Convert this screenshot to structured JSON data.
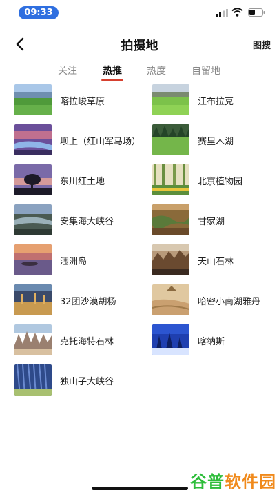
{
  "status_bar": {
    "time": "09:33",
    "icons": [
      "signal-icon",
      "wifi-icon",
      "battery-icon"
    ]
  },
  "header": {
    "title": "拍摄地",
    "right_action": "图搜",
    "back_icon": "chevron-left-icon"
  },
  "tabs": [
    {
      "label": "关注",
      "active": false
    },
    {
      "label": "热推",
      "active": true
    },
    {
      "label": "热度",
      "active": false
    },
    {
      "label": "自留地",
      "active": false
    }
  ],
  "places": [
    {
      "name": "喀拉峻草原",
      "thumb": "grassland"
    },
    {
      "name": "江布拉克",
      "thumb": "green-field"
    },
    {
      "name": "坝上（红山军马场）",
      "thumb": "purple-river"
    },
    {
      "name": "赛里木湖",
      "thumb": "lake-forest"
    },
    {
      "name": "东川红土地",
      "thumb": "tree-sunset"
    },
    {
      "name": "北京植物园",
      "thumb": "botanical-garden"
    },
    {
      "name": "安集海大峡谷",
      "thumb": "canyon"
    },
    {
      "name": "甘家湖",
      "thumb": "wetland"
    },
    {
      "name": "涠洲岛",
      "thumb": "island-sunset"
    },
    {
      "name": "天山石林",
      "thumb": "stone-forest"
    },
    {
      "name": "32团沙漠胡杨",
      "thumb": "desert-poplar"
    },
    {
      "name": "哈密小南湖雅丹",
      "thumb": "yardang"
    },
    {
      "name": "克托海特石林",
      "thumb": "rock-spires"
    },
    {
      "name": "喀纳斯",
      "thumb": "snow-forest"
    },
    {
      "name": "独山子大峡谷",
      "thumb": "blue-canyon"
    }
  ],
  "watermark": {
    "part1": "谷普",
    "part2": "软件园"
  },
  "colors": {
    "accent": "#d6402f",
    "time_pill": "#2f6fe0",
    "watermark_green": "#2dbd3a",
    "watermark_orange": "#f08a1c"
  }
}
